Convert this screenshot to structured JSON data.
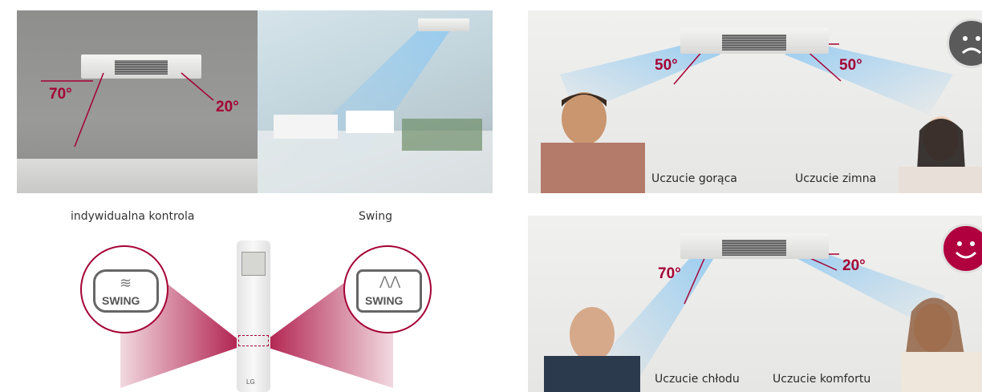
{
  "left": {
    "angle_left": "70°",
    "angle_right": "20°",
    "caption_individual": "indywidualna kontrola",
    "caption_swing": "Swing"
  },
  "remote": {
    "button_left_label": "SWING",
    "button_right_label": "SWING",
    "brand": "LG"
  },
  "top_right": {
    "angle_left": "50°",
    "angle_right": "50°",
    "feel_left": "Uczucie gorąca",
    "feel_right": "Uczucie zimna",
    "face": "sad-face-icon"
  },
  "bottom_right": {
    "angle_left": "70°",
    "angle_right": "20°",
    "feel_left": "Uczucie chłodu",
    "feel_right": "Uczucie komfortu",
    "face": "happy-face-icon"
  },
  "colors": {
    "accent": "#a50034",
    "airflow": "#8fc8f0"
  }
}
